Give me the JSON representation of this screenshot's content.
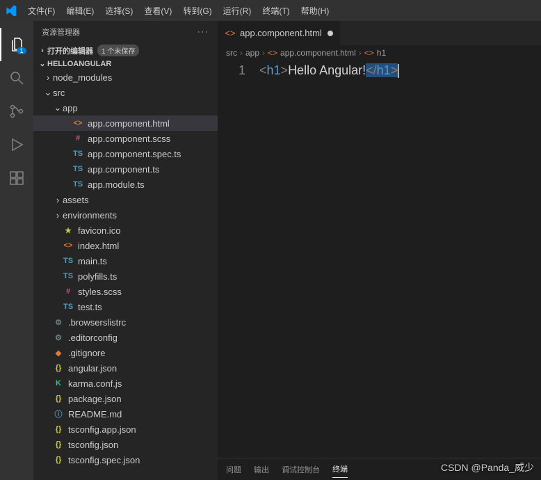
{
  "menu": [
    "文件(F)",
    "编辑(E)",
    "选择(S)",
    "查看(V)",
    "转到(G)",
    "运行(R)",
    "终端(T)",
    "帮助(H)"
  ],
  "activity": {
    "badge": "1"
  },
  "sidebar": {
    "title": "资源管理器",
    "openEditors": {
      "label": "打开的编辑器",
      "unsaved": "1 个未保存"
    },
    "project": "HELLOANGULAR",
    "tree": {
      "node_modules": "node_modules",
      "src": "src",
      "app": "app",
      "app_component_html": "app.component.html",
      "app_component_scss": "app.component.scss",
      "app_component_spec_ts": "app.component.spec.ts",
      "app_component_ts": "app.component.ts",
      "app_module_ts": "app.module.ts",
      "assets": "assets",
      "environments": "environments",
      "favicon_ico": "favicon.ico",
      "index_html": "index.html",
      "main_ts": "main.ts",
      "polyfills_ts": "polyfills.ts",
      "styles_scss": "styles.scss",
      "test_ts": "test.ts",
      "browserslistrc": ".browserslistrc",
      "editorconfig": ".editorconfig",
      "gitignore": ".gitignore",
      "angular_json": "angular.json",
      "karma_conf_js": "karma.conf.js",
      "package_json": "package.json",
      "readme_md": "README.md",
      "tsconfig_app_json": "tsconfig.app.json",
      "tsconfig_json": "tsconfig.json",
      "tsconfig_spec_json": "tsconfig.spec.json"
    }
  },
  "tab": {
    "name": "app.component.html"
  },
  "breadcrumbs": {
    "src": "src",
    "app": "app",
    "file": "app.component.html",
    "symbol": "h1"
  },
  "code": {
    "line_no": "1",
    "open_bracket": "<",
    "tag_open": "h1",
    "close_bracket": ">",
    "text": "Hello Angular!",
    "open_bracket2": "<",
    "slash": "/",
    "tag_close": "h1",
    "close_bracket2": ">"
  },
  "panel": {
    "problems": "问题",
    "output": "输出",
    "debug": "调试控制台",
    "terminal": "终端"
  },
  "watermark": "CSDN @Panda_威少"
}
